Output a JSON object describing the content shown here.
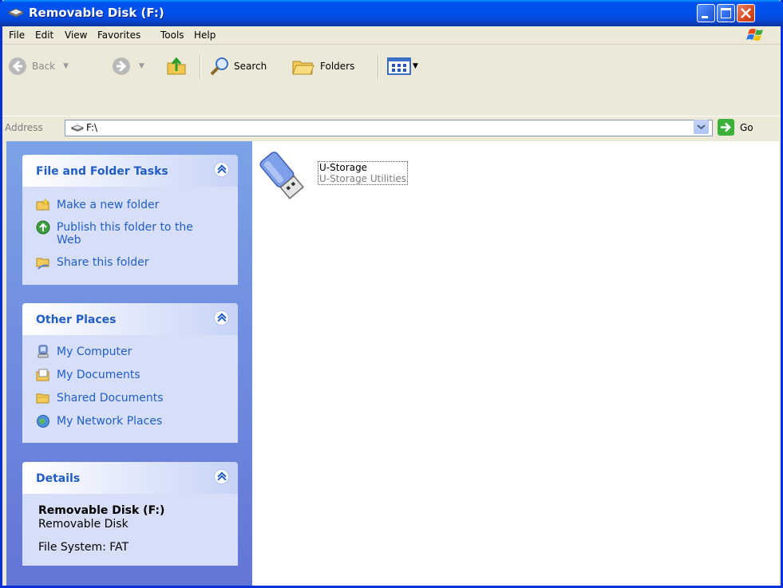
{
  "window": {
    "title": "Removable Disk (F:)"
  },
  "menu": {
    "items": [
      "File",
      "Edit",
      "View",
      "Favorites",
      "Tools",
      "Help"
    ]
  },
  "toolbar": {
    "back": "Back",
    "search": "Search",
    "folders": "Folders"
  },
  "address": {
    "label": "Address",
    "value": "F:\\",
    "go": "Go"
  },
  "sidebar": {
    "file_tasks": {
      "title": "File and Folder Tasks",
      "items": [
        "Make a new folder",
        "Publish this folder to the",
        "Web",
        "Share this folder"
      ]
    },
    "other_places": {
      "title": "Other Places",
      "items": [
        "My Computer",
        "My Documents",
        "Shared Documents",
        "My Network Places"
      ]
    },
    "details": {
      "title": "Details",
      "name": "Removable Disk (F:)",
      "type": "Removable Disk",
      "filesystem": "File System: FAT"
    }
  },
  "files": [
    {
      "name": "U-Storage",
      "subtitle": "U-Storage Utilities",
      "icon": "usb-drive-icon"
    }
  ]
}
